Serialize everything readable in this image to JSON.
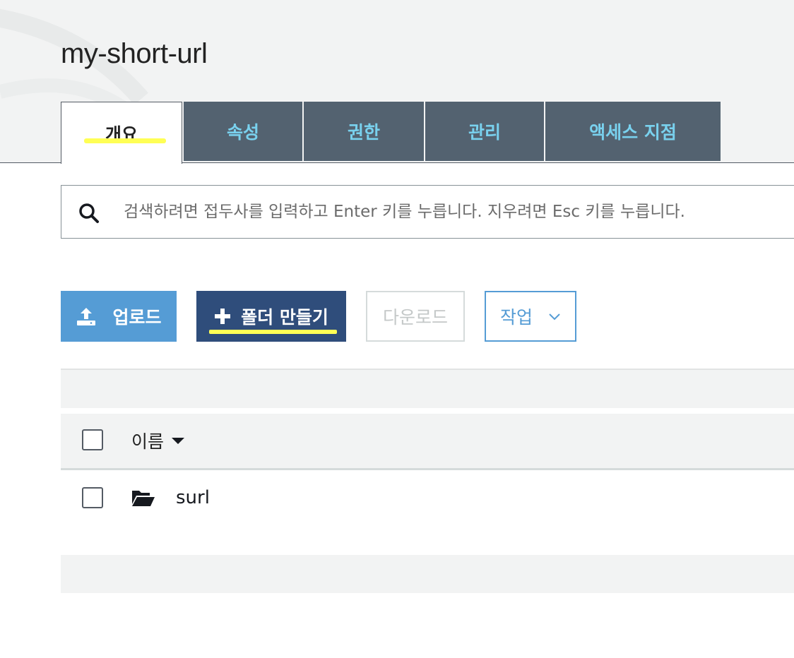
{
  "bucket": {
    "title": "my-short-url"
  },
  "tabs": [
    {
      "label": "개요",
      "active": true
    },
    {
      "label": "속성"
    },
    {
      "label": "권한"
    },
    {
      "label": "관리"
    },
    {
      "label": "액세스 지점"
    }
  ],
  "search": {
    "icon": "search-icon",
    "placeholder": "검색하려면 접두사를 입력하고 Enter 키를 누릅니다. 지우려면 Esc 키를 누릅니다."
  },
  "toolbar": {
    "upload_label": "업로드",
    "create_folder_label": "폴더 만들기",
    "download_label": "다운로드",
    "actions_label": "작업"
  },
  "table": {
    "name_header": "이름",
    "rows": [
      {
        "name": "surl",
        "type": "folder"
      }
    ]
  },
  "colors": {
    "tab_bg": "#536270",
    "tab_text": "#79d1ee",
    "upload_bg": "#559cd5",
    "create_folder_bg": "#2f4d7b",
    "highlight": "#ffff55"
  }
}
